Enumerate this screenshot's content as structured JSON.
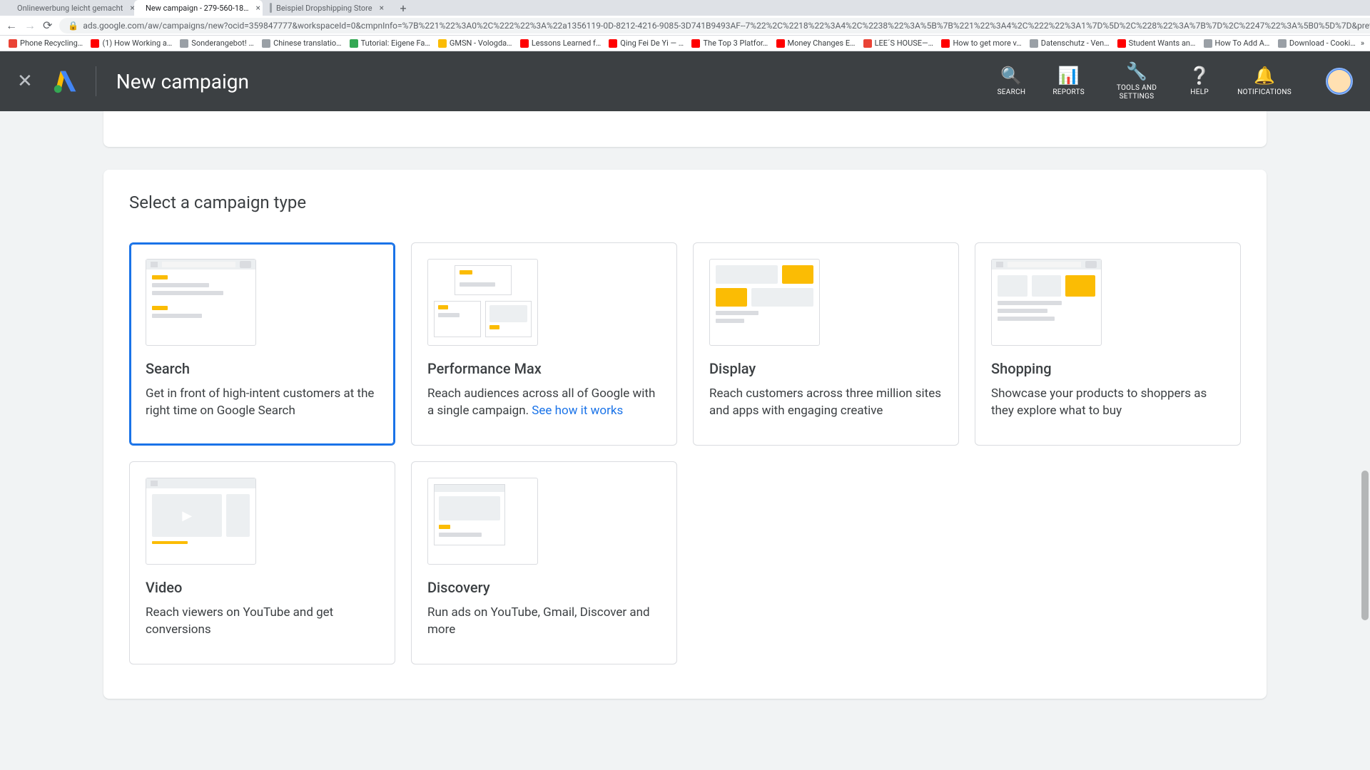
{
  "browser": {
    "tabs": [
      {
        "label": "Onlinewerbung leicht gemacht"
      },
      {
        "label": "New campaign - 279-560-18…"
      },
      {
        "label": "Beispiel Dropshipping Store"
      }
    ],
    "url": "ads.google.com/aw/campaigns/new?ocid=359847777&workspaceId=0&cmpnInfo=%7B%221%22%3A0%2C%222%22%3A%22a1356119-0D-8212-4216-9085-3D741B9493AF--7%22%2C%2218%22%3A4%2C%2238%22%3A%5B%7B%221%22%3A4%2C%222%22%3A1%7D%5D%2C%228%22%3A%7B%7D%2C%2247%22%3A%5B0%5D%7D&prefill=%7B%7D&subid=de-de-et-g-aw-c-home-awhp_xin1_…",
    "bookmarks": [
      "Phone Recycling…",
      "(1) How Working a…",
      "Sonderangebot! …",
      "Chinese translatio…",
      "Tutorial: Eigene Fa…",
      "GMSN - Vologda…",
      "Lessons Learned f…",
      "Qing Fei De Yi — …",
      "The Top 3 Platfor…",
      "Money Changes E…",
      "LEE´S HOUSE—…",
      "How to get more v…",
      "Datenschutz - Ven…",
      "Student Wants an…",
      "How To Add A…",
      "Download - Cooki…"
    ]
  },
  "header": {
    "page_title": "New campaign",
    "actions": {
      "search": "SEARCH",
      "reports": "REPORTS",
      "tools": "TOOLS AND SETTINGS",
      "help": "HELP",
      "notifications": "NOTIFICATIONS"
    }
  },
  "section": {
    "title": "Select a campaign type"
  },
  "types": {
    "search": {
      "title": "Search",
      "desc": "Get in front of high-intent customers at the right time on Google Search"
    },
    "pmax": {
      "title": "Performance Max",
      "desc": "Reach audiences across all of Google with a single campaign. ",
      "link": "See how it works"
    },
    "display": {
      "title": "Display",
      "desc": "Reach customers across three million sites and apps with engaging creative"
    },
    "shopping": {
      "title": "Shopping",
      "desc": "Showcase your products to shoppers as they explore what to buy"
    },
    "video": {
      "title": "Video",
      "desc": "Reach viewers on YouTube and get conversions"
    },
    "discovery": {
      "title": "Discovery",
      "desc": "Run ads on YouTube, Gmail, Discover and more"
    }
  }
}
